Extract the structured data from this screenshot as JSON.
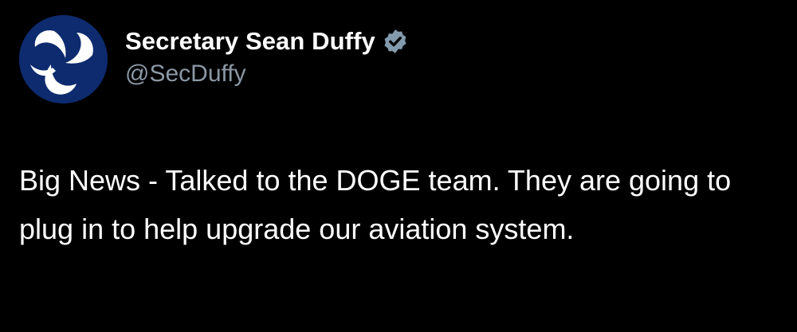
{
  "author": {
    "display_name": "Secretary Sean Duffy",
    "handle": "@SecDuffy",
    "verified": true,
    "avatar_icon": "dot-triskelion-logo-icon"
  },
  "tweet": {
    "text": "Big News - Talked to the DOGE team. They are going to plug in to help upgrade our aviation system."
  },
  "colors": {
    "background": "#000000",
    "name_text": "#ffffff",
    "handle_text": "#8b98a5",
    "body_text": "#ffffff",
    "avatar_bg": "#0d2b6e",
    "verified_badge": "#829aab"
  }
}
